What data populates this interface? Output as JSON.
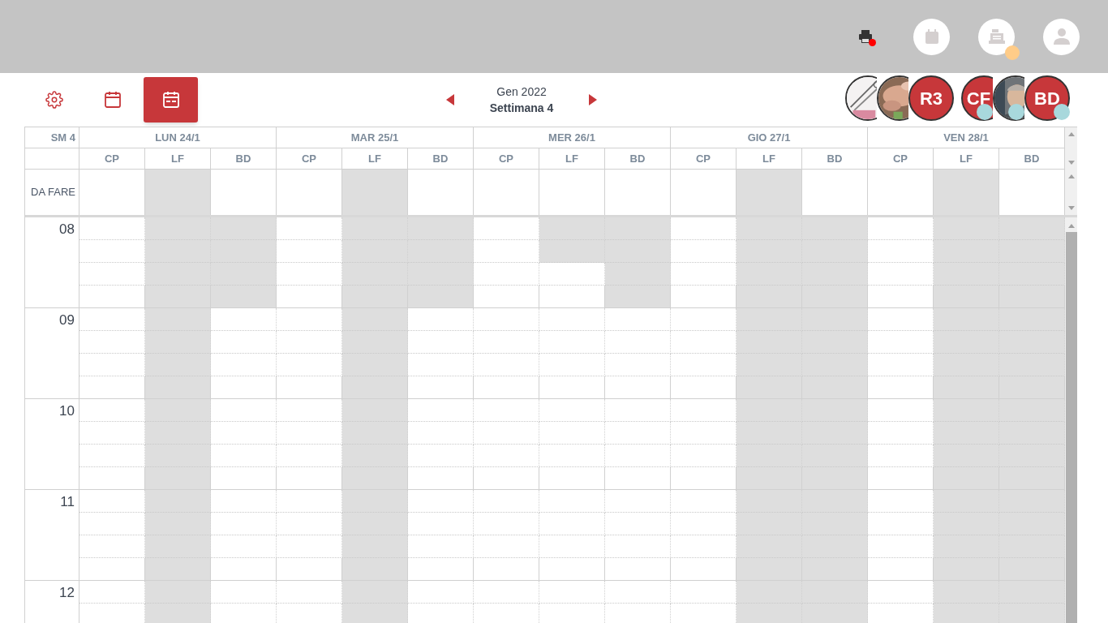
{
  "top_icons": [
    {
      "kind": "printer",
      "color": "#ff0000"
    },
    {
      "kind": "calendar"
    },
    {
      "kind": "register",
      "color": "#ffcc88"
    },
    {
      "kind": "user"
    }
  ],
  "view_buttons": [
    {
      "kind": "settings",
      "selected": false
    },
    {
      "kind": "calendar",
      "selected": false
    },
    {
      "kind": "week",
      "selected": true
    }
  ],
  "period": {
    "month": "Gen 2022",
    "week": "Settimana 4"
  },
  "avatar_groups": [
    [
      {
        "kind": "picture",
        "status": false
      },
      {
        "kind": "picture",
        "status": false
      },
      {
        "kind": "initials",
        "text": "R3",
        "status": false
      }
    ],
    [
      {
        "kind": "initials",
        "text": "CF",
        "status": true
      },
      {
        "kind": "picture",
        "status": true
      },
      {
        "kind": "initials",
        "text": "BD",
        "status": true
      }
    ]
  ],
  "week_label": "SM 4",
  "todo_label": "DA FARE",
  "hours": [
    "08",
    "09",
    "10",
    "11",
    "12"
  ],
  "days": [
    {
      "label": "LUN 24/1",
      "staff": [
        {
          "label": "CP",
          "todo_blocked": false,
          "slots": [
            false,
            false,
            false,
            false,
            false,
            false,
            false,
            false,
            false,
            false,
            false,
            false,
            false,
            false,
            false,
            false,
            false,
            false
          ]
        },
        {
          "label": "LF",
          "todo_blocked": true,
          "slots": [
            true,
            true,
            true,
            true,
            true,
            true,
            true,
            true,
            true,
            true,
            true,
            true,
            true,
            true,
            true,
            true,
            true,
            true
          ]
        },
        {
          "label": "BD",
          "todo_blocked": false,
          "slots": [
            true,
            true,
            true,
            true,
            false,
            false,
            false,
            false,
            false,
            false,
            false,
            false,
            false,
            false,
            false,
            false,
            false,
            false
          ]
        }
      ]
    },
    {
      "label": "MAR 25/1",
      "staff": [
        {
          "label": "CP",
          "todo_blocked": false,
          "slots": [
            false,
            false,
            false,
            false,
            false,
            false,
            false,
            false,
            false,
            false,
            false,
            false,
            false,
            false,
            false,
            false,
            false,
            false
          ]
        },
        {
          "label": "LF",
          "todo_blocked": true,
          "slots": [
            true,
            true,
            true,
            true,
            true,
            true,
            true,
            true,
            true,
            true,
            true,
            true,
            true,
            true,
            true,
            true,
            true,
            true
          ]
        },
        {
          "label": "BD",
          "todo_blocked": false,
          "slots": [
            true,
            true,
            true,
            true,
            false,
            false,
            false,
            false,
            false,
            false,
            false,
            false,
            false,
            false,
            false,
            false,
            false,
            false
          ]
        }
      ]
    },
    {
      "label": "MER 26/1",
      "staff": [
        {
          "label": "CP",
          "todo_blocked": false,
          "slots": [
            false,
            false,
            false,
            false,
            false,
            false,
            false,
            false,
            false,
            false,
            false,
            false,
            false,
            false,
            false,
            false,
            false,
            false
          ]
        },
        {
          "label": "LF",
          "todo_blocked": false,
          "slots": [
            true,
            true,
            false,
            false,
            false,
            false,
            false,
            false,
            false,
            false,
            false,
            false,
            false,
            false,
            false,
            false,
            false,
            false
          ]
        },
        {
          "label": "BD",
          "todo_blocked": false,
          "slots": [
            true,
            true,
            true,
            true,
            false,
            false,
            false,
            false,
            false,
            false,
            false,
            false,
            false,
            false,
            false,
            false,
            false,
            false
          ]
        }
      ]
    },
    {
      "label": "GIO 27/1",
      "staff": [
        {
          "label": "CP",
          "todo_blocked": false,
          "slots": [
            false,
            false,
            false,
            false,
            false,
            false,
            false,
            false,
            false,
            false,
            false,
            false,
            false,
            false,
            false,
            false,
            false,
            false
          ]
        },
        {
          "label": "LF",
          "todo_blocked": true,
          "slots": [
            true,
            true,
            true,
            true,
            true,
            true,
            true,
            true,
            true,
            true,
            true,
            true,
            true,
            true,
            true,
            true,
            true,
            true
          ]
        },
        {
          "label": "BD",
          "todo_blocked": false,
          "slots": [
            true,
            true,
            true,
            true,
            true,
            true,
            true,
            true,
            true,
            true,
            true,
            true,
            true,
            true,
            true,
            true,
            true,
            true
          ]
        }
      ]
    },
    {
      "label": "VEN 28/1",
      "staff": [
        {
          "label": "CP",
          "todo_blocked": false,
          "slots": [
            false,
            false,
            false,
            false,
            false,
            false,
            false,
            false,
            false,
            false,
            false,
            false,
            false,
            false,
            false,
            false,
            false,
            false
          ]
        },
        {
          "label": "LF",
          "todo_blocked": true,
          "slots": [
            true,
            true,
            true,
            true,
            true,
            true,
            true,
            true,
            true,
            true,
            true,
            true,
            true,
            true,
            true,
            true,
            true,
            true
          ]
        },
        {
          "label": "BD",
          "todo_blocked": false,
          "slots": [
            true,
            true,
            true,
            true,
            true,
            true,
            true,
            true,
            true,
            true,
            true,
            true,
            true,
            true,
            true,
            true,
            true,
            true
          ]
        }
      ]
    }
  ]
}
